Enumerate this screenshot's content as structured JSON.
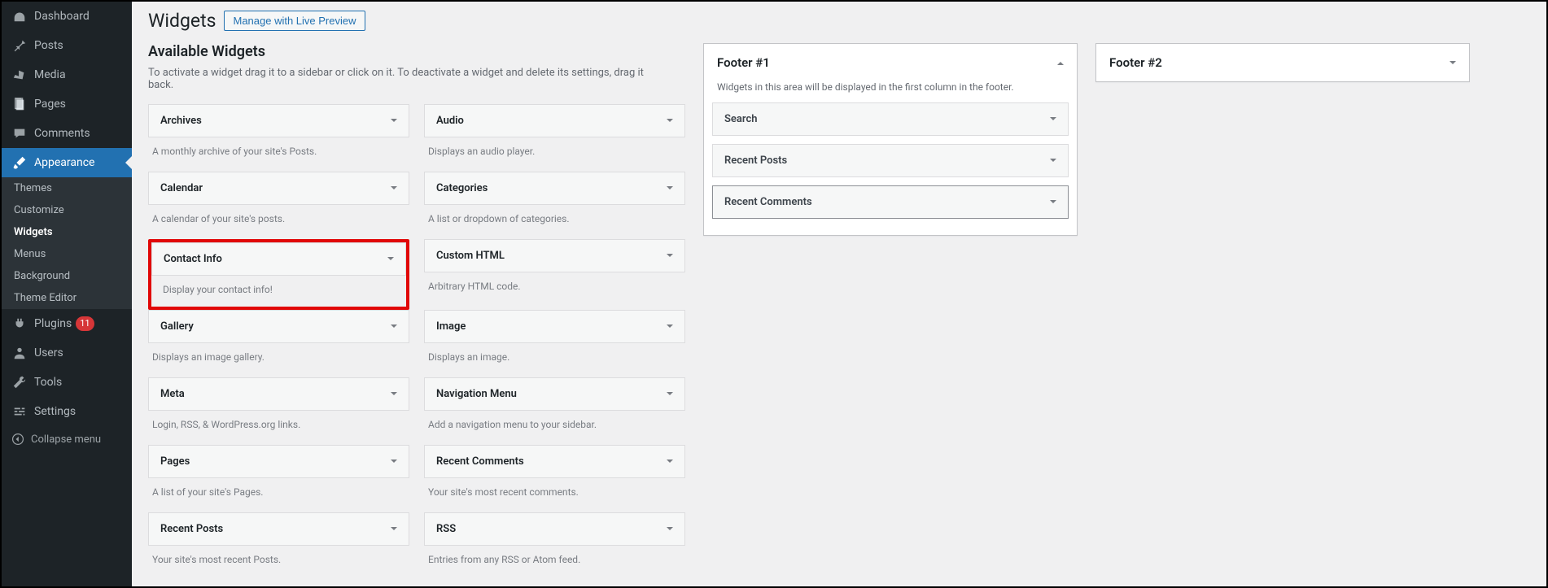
{
  "sidebar": {
    "items": [
      {
        "name": "dashboard",
        "label": "Dashboard",
        "icon": "dashboard-icon"
      },
      {
        "name": "posts",
        "label": "Posts",
        "icon": "pin-icon"
      },
      {
        "name": "media",
        "label": "Media",
        "icon": "media-icon"
      },
      {
        "name": "pages",
        "label": "Pages",
        "icon": "pages-icon"
      },
      {
        "name": "comments",
        "label": "Comments",
        "icon": "comment-icon"
      },
      {
        "name": "appearance",
        "label": "Appearance",
        "icon": "brush-icon",
        "current": true
      },
      {
        "name": "plugins",
        "label": "Plugins",
        "icon": "plug-icon",
        "badge": "11"
      },
      {
        "name": "users",
        "label": "Users",
        "icon": "user-icon"
      },
      {
        "name": "tools",
        "label": "Tools",
        "icon": "wrench-icon"
      },
      {
        "name": "settings",
        "label": "Settings",
        "icon": "sliders-icon"
      }
    ],
    "appearance_sub": [
      {
        "name": "themes",
        "label": "Themes"
      },
      {
        "name": "customize",
        "label": "Customize"
      },
      {
        "name": "widgets",
        "label": "Widgets",
        "current": true
      },
      {
        "name": "menus",
        "label": "Menus"
      },
      {
        "name": "background",
        "label": "Background"
      },
      {
        "name": "theme-editor",
        "label": "Theme Editor"
      }
    ],
    "collapse_label": "Collapse menu"
  },
  "page": {
    "title": "Widgets",
    "manage_button": "Manage with Live Preview",
    "available_heading": "Available Widgets",
    "available_help": "To activate a widget drag it to a sidebar or click on it. To deactivate a widget and delete its settings, drag it back."
  },
  "available_widgets": [
    {
      "name": "archives",
      "title": "Archives",
      "desc": "A monthly archive of your site's Posts."
    },
    {
      "name": "audio",
      "title": "Audio",
      "desc": "Displays an audio player."
    },
    {
      "name": "calendar",
      "title": "Calendar",
      "desc": "A calendar of your site's posts."
    },
    {
      "name": "categories",
      "title": "Categories",
      "desc": "A list or dropdown of categories."
    },
    {
      "name": "contact-info",
      "title": "Contact Info",
      "desc": "Display your contact info!",
      "highlight": true
    },
    {
      "name": "custom-html",
      "title": "Custom HTML",
      "desc": "Arbitrary HTML code."
    },
    {
      "name": "gallery",
      "title": "Gallery",
      "desc": "Displays an image gallery."
    },
    {
      "name": "image",
      "title": "Image",
      "desc": "Displays an image."
    },
    {
      "name": "meta",
      "title": "Meta",
      "desc": "Login, RSS, & WordPress.org links."
    },
    {
      "name": "nav-menu",
      "title": "Navigation Menu",
      "desc": "Add a navigation menu to your sidebar."
    },
    {
      "name": "pages",
      "title": "Pages",
      "desc": "A list of your site's Pages."
    },
    {
      "name": "recent-comments",
      "title": "Recent Comments",
      "desc": "Your site's most recent comments."
    },
    {
      "name": "recent-posts",
      "title": "Recent Posts",
      "desc": "Your site's most recent Posts."
    },
    {
      "name": "rss",
      "title": "RSS",
      "desc": "Entries from any RSS or Atom feed."
    }
  ],
  "widget_areas": [
    {
      "name": "footer-1",
      "title": "Footer #1",
      "expanded": true,
      "desc": "Widgets in this area will be displayed in the first column in the footer.",
      "widgets": [
        {
          "name": "search",
          "title": "Search"
        },
        {
          "name": "recent-posts",
          "title": "Recent Posts"
        },
        {
          "name": "recent-comments",
          "title": "Recent Comments",
          "active": true
        }
      ]
    },
    {
      "name": "footer-2",
      "title": "Footer #2",
      "expanded": false
    }
  ]
}
